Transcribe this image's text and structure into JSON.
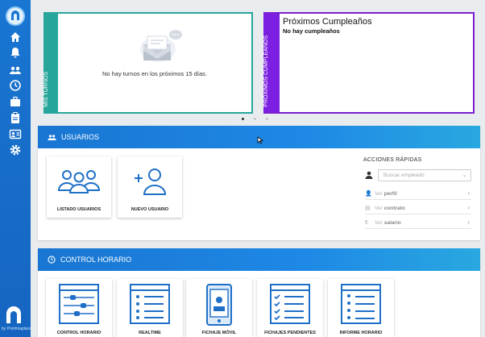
{
  "sidebar": {
    "brand_text": "by Pointmaplace",
    "items": [
      {
        "icon": "home-icon"
      },
      {
        "icon": "bell-icon"
      },
      {
        "icon": "users-icon"
      },
      {
        "icon": "clock-icon"
      },
      {
        "icon": "briefcase-icon"
      },
      {
        "icon": "clipboard-icon"
      },
      {
        "icon": "id-card-icon"
      },
      {
        "icon": "gear-icon"
      }
    ]
  },
  "turnos": {
    "side_label": "MIS TURNOS",
    "empty_message": "No hay turnos en los próximos 15 días."
  },
  "cumpleanos": {
    "side_label": "PRÓXIMOS CUMPLEAÑOS",
    "title": "Próximos Cumpleaños",
    "subtitle": "No hay cumpleaños"
  },
  "usuarios": {
    "header": "USUARIOS",
    "tiles": [
      {
        "label": "LISTADO USUARIOS"
      },
      {
        "label": "NUEVO USUARIO"
      }
    ]
  },
  "acciones": {
    "title": "ACCIONES RÁPIDAS",
    "search_placeholder": "Buscar empleado",
    "items": [
      {
        "prefix": "Ver",
        "bold": "perfil"
      },
      {
        "prefix": "Ver",
        "bold": "contrato"
      },
      {
        "prefix": "Ver",
        "bold": "salario"
      }
    ]
  },
  "control": {
    "header": "CONTROL HORARIO",
    "tiles": [
      {
        "label": "CONTROL HORARIO"
      },
      {
        "label": "REALTIME"
      },
      {
        "label": "FICHAJE MÓVIL"
      },
      {
        "label": "FICHAJES PENDIENTES"
      },
      {
        "label": "INFORME HORARIO"
      }
    ]
  },
  "colors": {
    "primary": "#1976d2",
    "turnos_accent": "#26a69a",
    "cumple_accent": "#7b1fe0"
  }
}
